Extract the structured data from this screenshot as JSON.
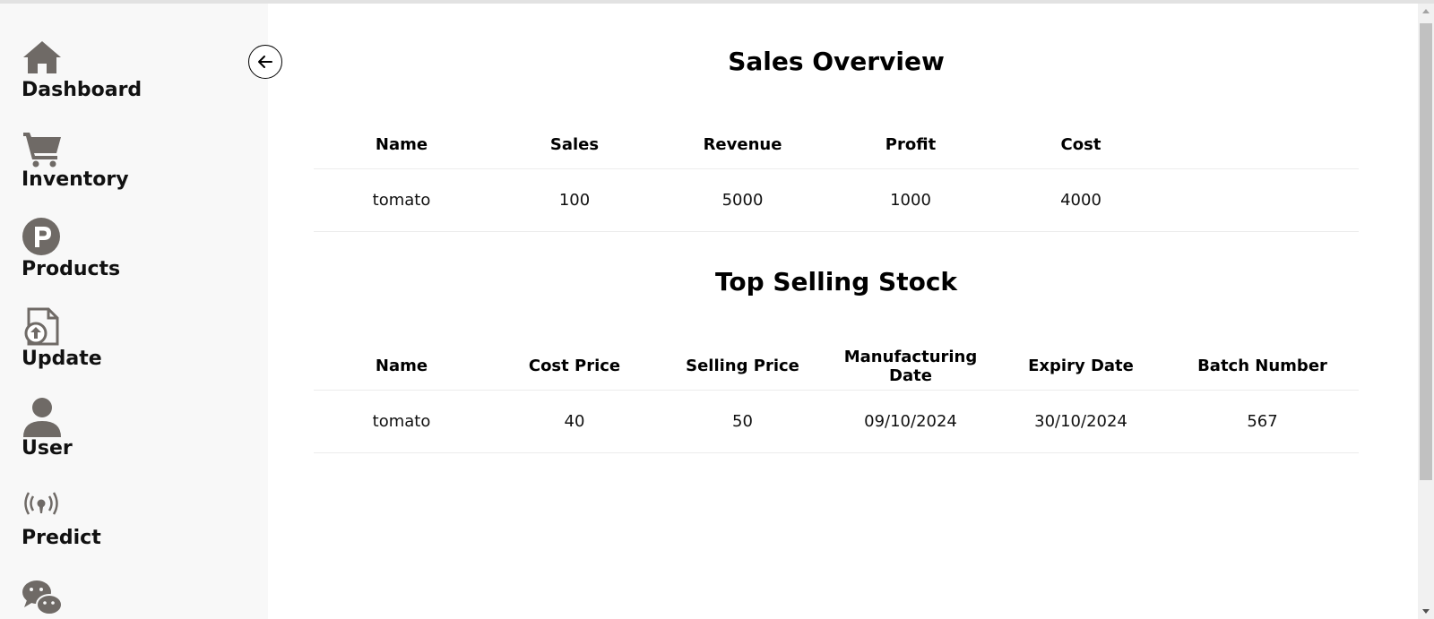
{
  "sidebar": {
    "items": [
      {
        "label": "Dashboard",
        "icon": "home-icon"
      },
      {
        "label": "Inventory",
        "icon": "cart-icon"
      },
      {
        "label": "Products",
        "icon": "product-p-icon"
      },
      {
        "label": "Update",
        "icon": "file-upload-icon"
      },
      {
        "label": "User",
        "icon": "user-icon"
      },
      {
        "label": "Predict",
        "icon": "broadcast-icon"
      },
      {
        "label": "",
        "icon": "chat-icon"
      }
    ],
    "collapse_icon": "arrow-left-icon",
    "icon_color": "#6f6a66"
  },
  "sales_overview": {
    "title": "Sales Overview",
    "headers": [
      "Name",
      "Sales",
      "Revenue",
      "Profit",
      "Cost",
      ""
    ],
    "rows": [
      [
        "tomato",
        "100",
        "5000",
        "1000",
        "4000",
        ""
      ]
    ]
  },
  "top_selling": {
    "title": "Top Selling Stock",
    "headers": [
      "Name",
      "Cost Price",
      "Selling Price",
      "Manufacturing Date",
      "Expiry Date",
      "Batch Number"
    ],
    "rows": [
      [
        "tomato",
        "40",
        "50",
        "09/10/2024",
        "30/10/2024",
        "567"
      ]
    ]
  }
}
